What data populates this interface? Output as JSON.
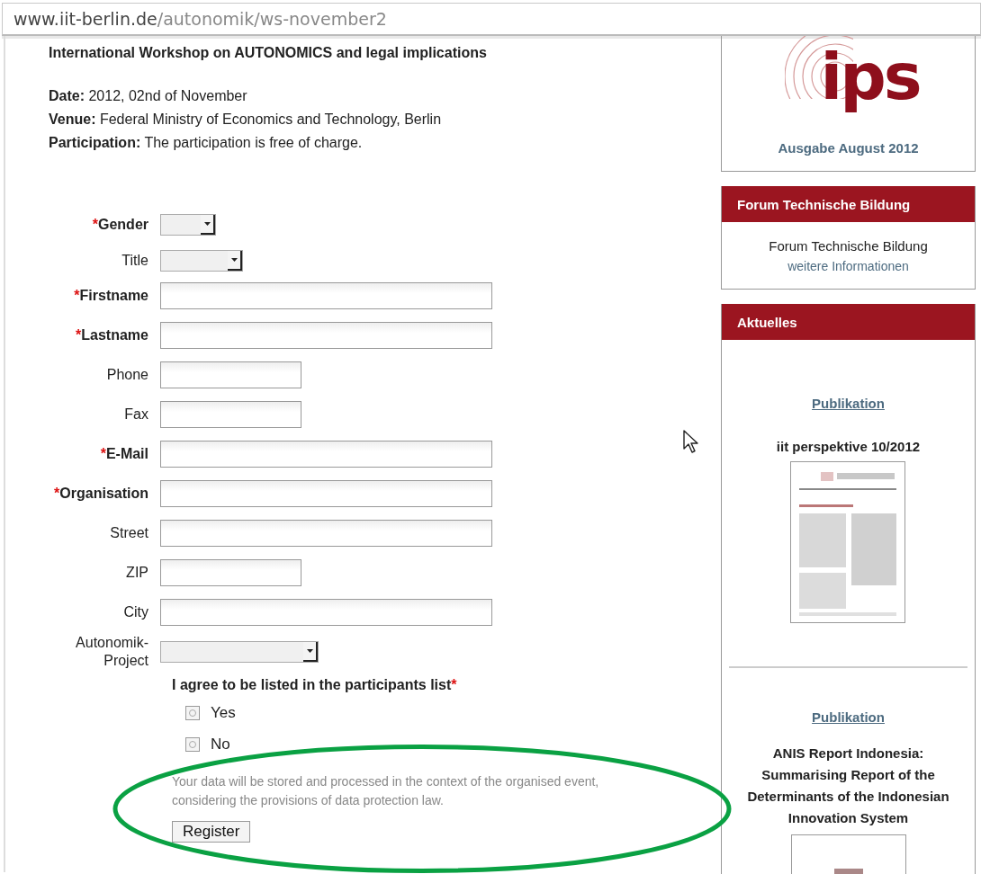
{
  "address_bar": {
    "host": "www.iit-berlin.de",
    "path": "/autonomik/ws-november2"
  },
  "event": {
    "title": "International Workshop on AUTONOMICS and legal implications",
    "details": [
      {
        "label": "Date:",
        "value": "2012, 02nd of November"
      },
      {
        "label": "Venue:",
        "value": "Federal Ministry of Economics and Technology, Berlin"
      },
      {
        "label": "Participation:",
        "value": "The participation is free of charge."
      }
    ]
  },
  "form": {
    "fields": [
      {
        "label": "Gender",
        "marker": "*",
        "required": true,
        "kind": "smallselect"
      },
      {
        "label": "Title",
        "required": false,
        "kind": "select"
      },
      {
        "label": "Firstname",
        "marker": "*",
        "required": true,
        "kind": "longtext"
      },
      {
        "label": "Lastname",
        "marker": "*",
        "required": true,
        "kind": "longtext"
      },
      {
        "label": "Phone",
        "required": false,
        "kind": "shorttext"
      },
      {
        "label": "Fax",
        "required": false,
        "kind": "shorttext"
      },
      {
        "label": "E-Mail",
        "marker": "*",
        "required": true,
        "kind": "longtext"
      },
      {
        "label": "Organisation",
        "marker": "*",
        "required": true,
        "kind": "longtext"
      },
      {
        "label": "Street",
        "required": false,
        "kind": "longtext"
      },
      {
        "label": "ZIP",
        "required": false,
        "kind": "shorttext"
      },
      {
        "label": "City",
        "required": false,
        "kind": "longtext"
      },
      {
        "label": "Autonomik-Project",
        "required": false,
        "kind": "wideselect"
      }
    ],
    "consent": {
      "question": "I agree to be listed in the participants list",
      "marker": "*",
      "options": [
        {
          "label": "Yes",
          "selected": false
        },
        {
          "label": "No",
          "selected": false
        }
      ]
    },
    "notice": "Your data will be stored and processed in the context of the organised event, considering the provisions of data protection law.",
    "submit": "Register"
  },
  "annotation": {
    "kind": "ellipse"
  },
  "sidebar": {
    "magazine": {
      "logo": "ips",
      "caption": "Ausgabe August 2012"
    },
    "forum": {
      "heading": "Forum Technische Bildung",
      "text": "Forum Technische Bildung",
      "link": "weitere Informationen"
    },
    "news": {
      "heading": "Aktuelles",
      "items": [
        {
          "category": "Publikation",
          "title": "iit perspektive 10/2012",
          "kind": "picture"
        },
        {
          "category": "Publikation",
          "title": "ANIS Report Indonesia: Summarising Report of the Determinants of the Indonesian Innovation System",
          "kind": "picture"
        }
      ]
    }
  }
}
